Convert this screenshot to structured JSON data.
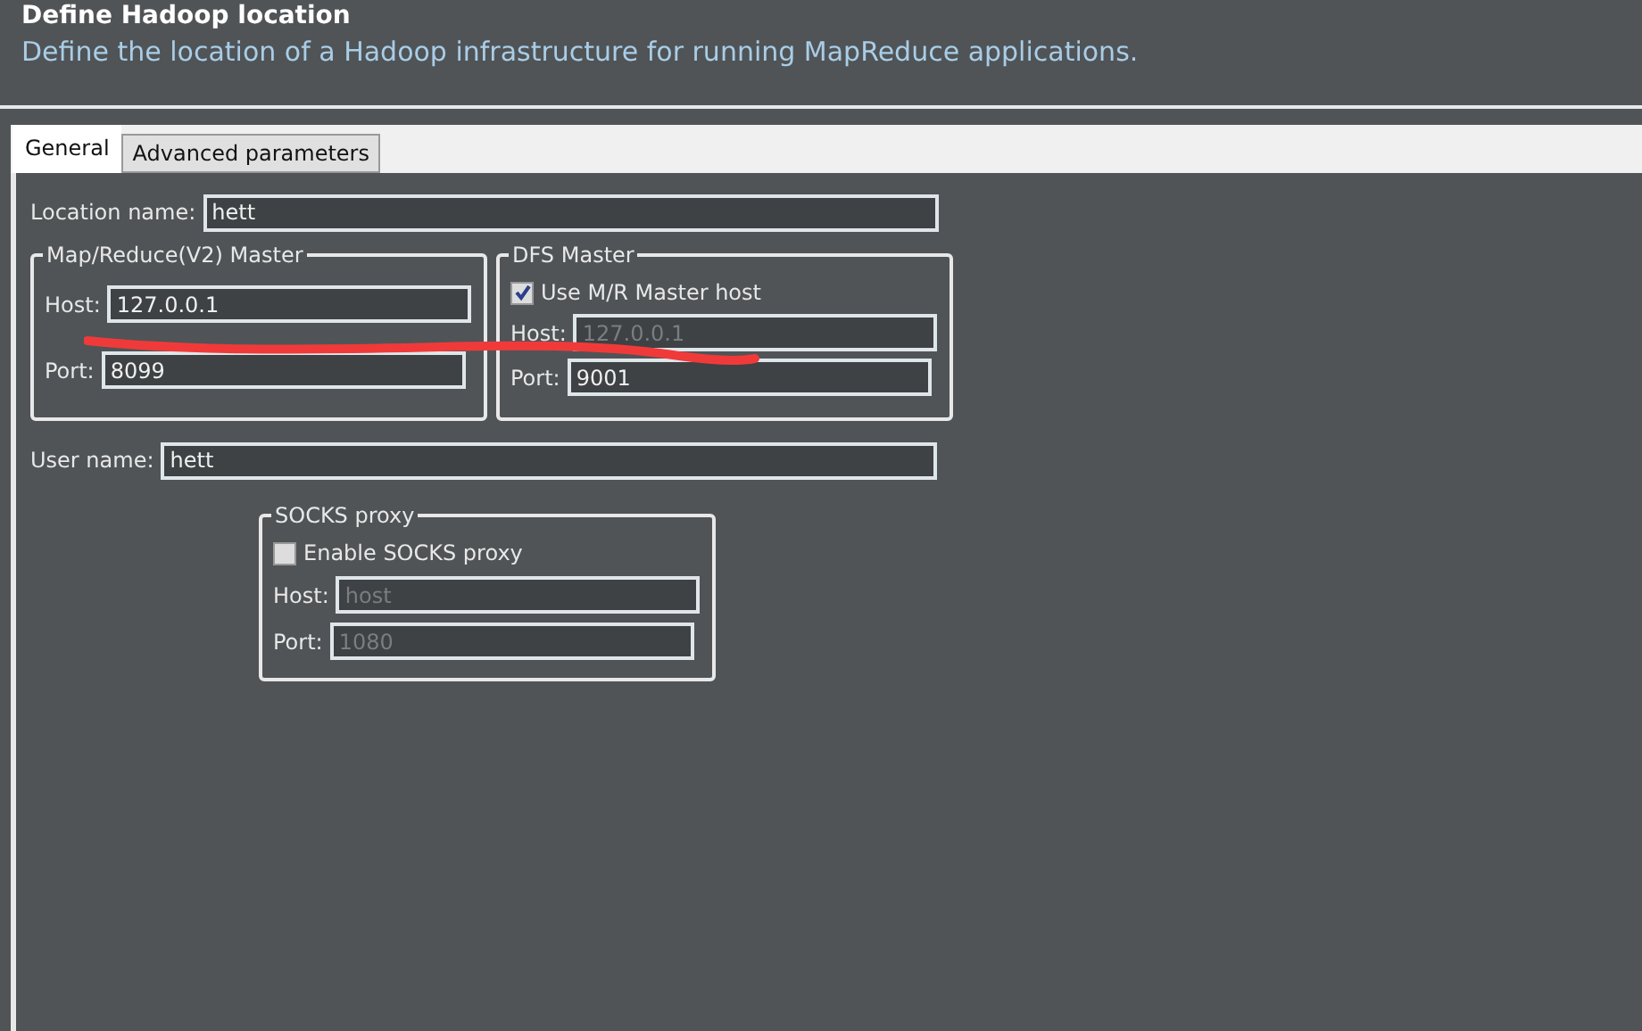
{
  "header": {
    "title": "Define Hadoop location",
    "description": "Define the location of a Hadoop infrastructure for running MapReduce applications."
  },
  "tabs": [
    {
      "label": "General",
      "selected": true
    },
    {
      "label": "Advanced parameters",
      "selected": false
    }
  ],
  "location_name": {
    "label": "Location name:",
    "value": "hett"
  },
  "mr_master": {
    "title": "Map/Reduce(V2) Master",
    "fields": [
      {
        "label": "Host:",
        "value": "127.0.0.1",
        "disabled": false
      },
      {
        "label": "Port:",
        "value": "8099",
        "disabled": false
      }
    ]
  },
  "dfs_master": {
    "title": "DFS Master",
    "checkbox": {
      "label": "Use M/R Master host",
      "checked": true
    },
    "fields": [
      {
        "label": "Host:",
        "value": "127.0.0.1",
        "disabled": true
      },
      {
        "label": "Port:",
        "value": "9001",
        "disabled": false
      }
    ]
  },
  "user_name": {
    "label": "User name:",
    "value": "hett"
  },
  "socks_proxy": {
    "title": "SOCKS proxy",
    "checkbox": {
      "label": "Enable SOCKS proxy",
      "checked": false
    },
    "fields": [
      {
        "label": "Host:",
        "value": "host",
        "disabled": true
      },
      {
        "label": "Port:",
        "value": "1080",
        "disabled": true
      }
    ]
  }
}
